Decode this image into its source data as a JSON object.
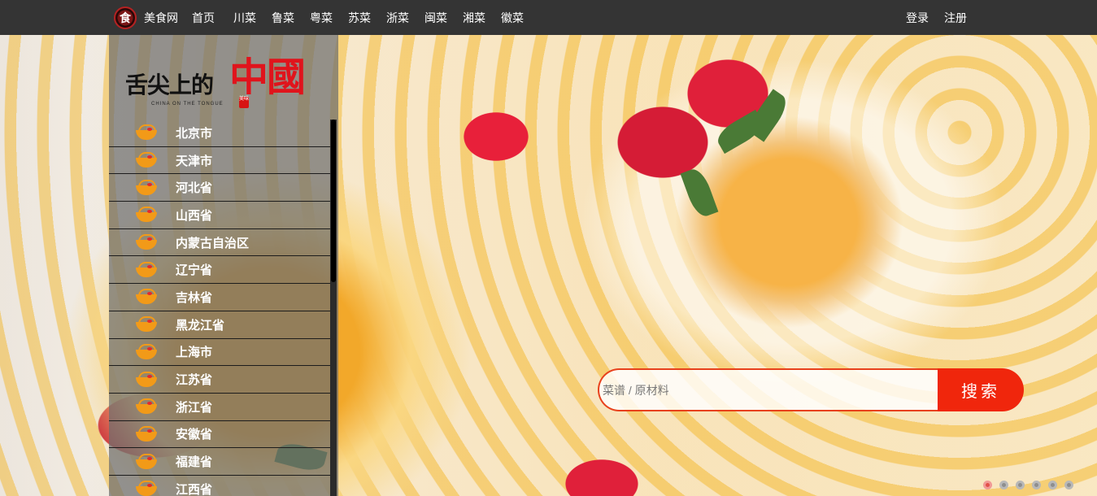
{
  "topbar": {
    "brand_logo_char": "食",
    "brand_name": "美食网",
    "nav": [
      {
        "label": "首页"
      },
      {
        "label": "川菜"
      },
      {
        "label": "鲁菜"
      },
      {
        "label": "粤菜"
      },
      {
        "label": "苏菜"
      },
      {
        "label": "浙菜"
      },
      {
        "label": "闽菜"
      },
      {
        "label": "湘菜"
      },
      {
        "label": "徽菜"
      }
    ],
    "login": "登录",
    "register": "注册"
  },
  "sidebar": {
    "logo_text_black": "舌尖上的",
    "logo_text_red": "中國",
    "logo_subtitle": "CHINA ON THE TONGUE",
    "logo_seal": "美味",
    "provinces": [
      {
        "label": "北京市"
      },
      {
        "label": "天津市"
      },
      {
        "label": "河北省"
      },
      {
        "label": "山西省"
      },
      {
        "label": "内蒙古自治区"
      },
      {
        "label": "辽宁省"
      },
      {
        "label": "吉林省"
      },
      {
        "label": "黑龙江省"
      },
      {
        "label": "上海市"
      },
      {
        "label": "江苏省"
      },
      {
        "label": "浙江省"
      },
      {
        "label": "安徽省"
      },
      {
        "label": "福建省"
      },
      {
        "label": "江西省"
      }
    ]
  },
  "search": {
    "placeholder": "菜谱 / 原材料",
    "value": "",
    "button_label": "搜索"
  },
  "carousel": {
    "slide_count": 6,
    "active_index": 0
  },
  "colors": {
    "topbar_bg": "#343434",
    "accent": "#f0260c",
    "bowl_icon": "#f29a18"
  }
}
